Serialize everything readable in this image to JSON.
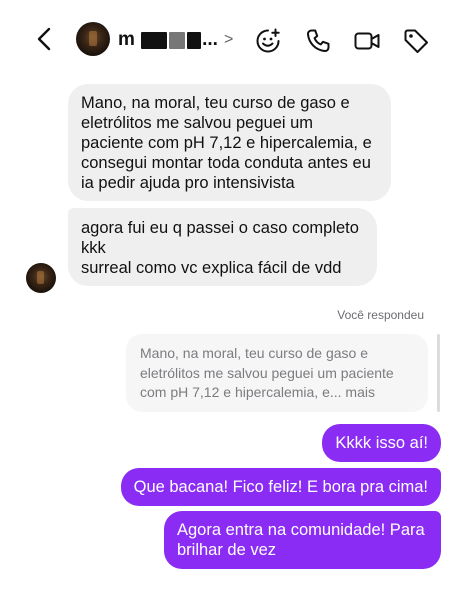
{
  "header": {
    "contact_name_visible": "m",
    "name_ellipsis": "...",
    "chevron": ">",
    "icons": [
      "back-arrow-icon",
      "avatar",
      "sticker-add-icon",
      "phone-icon",
      "video-camera-icon",
      "tag-icon"
    ]
  },
  "messages": {
    "incoming_1": {
      "lines": [
        "Mano, na moral, teu curso de gaso e",
        "eletrólitos me salvou peguei um",
        "paciente com pH 7,12 e hipercalemia, e",
        "consegui montar toda conduta antes eu",
        "ia pedir ajuda pro intensivista"
      ]
    },
    "incoming_2": {
      "lines": [
        "agora fui eu q passei o caso completo",
        "kkk",
        "surreal como vc explica fácil de vdd"
      ]
    },
    "replied_label": "Você respondeu",
    "quoted_reply": {
      "lines": [
        "Mano, na moral, teu curso de gaso e",
        "eletrólitos me salvou peguei um paciente",
        "com pH 7,12 e hipercalemia, e... mais"
      ]
    },
    "outgoing_1": "Kkkk isso aí!",
    "outgoing_2": "Que bacana! Fico feliz! E bora pra cima!",
    "outgoing_3": {
      "lines": [
        "Agora entra na comunidade! Para",
        "brilhar de vez"
      ]
    }
  },
  "colors": {
    "outgoing_bubble": "#8b2cf5",
    "incoming_bubble": "#efeff0",
    "quote_bubble": "#f6f6f7"
  }
}
